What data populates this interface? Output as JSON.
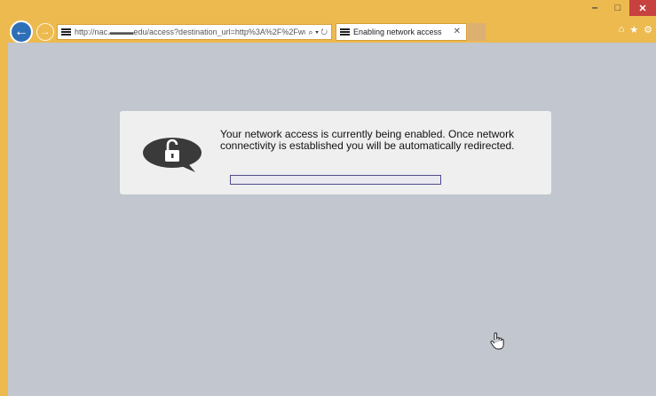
{
  "window": {
    "minimize": "‒",
    "maximize": "□",
    "close": "✕"
  },
  "nav": {
    "back_icon": "back-arrow-icon",
    "forward_icon": "forward-arrow-icon",
    "address": "http://nac.▬▬▬edu/access?destination_url=http%3A%2F%2Fww",
    "search_icon": "⌕",
    "dropdown_icon": "▾",
    "refresh_icon": "↻"
  },
  "tab": {
    "title": "Enabling network access",
    "close": "✕"
  },
  "tools": {
    "home": "⌂",
    "favorites": "★",
    "settings": "⚙"
  },
  "dialog": {
    "icon": "unlocked-padlock-speech-bubble-icon",
    "message": "Your network access is currently being enabled. Once network connectivity is established you will be automatically redirected.",
    "progress": 0.0
  },
  "colors": {
    "frame": "#edba50",
    "viewport": "#c1c6cf",
    "dialog": "#efefef",
    "back_button": "#2f6fb8",
    "close_button": "#c7413f"
  }
}
